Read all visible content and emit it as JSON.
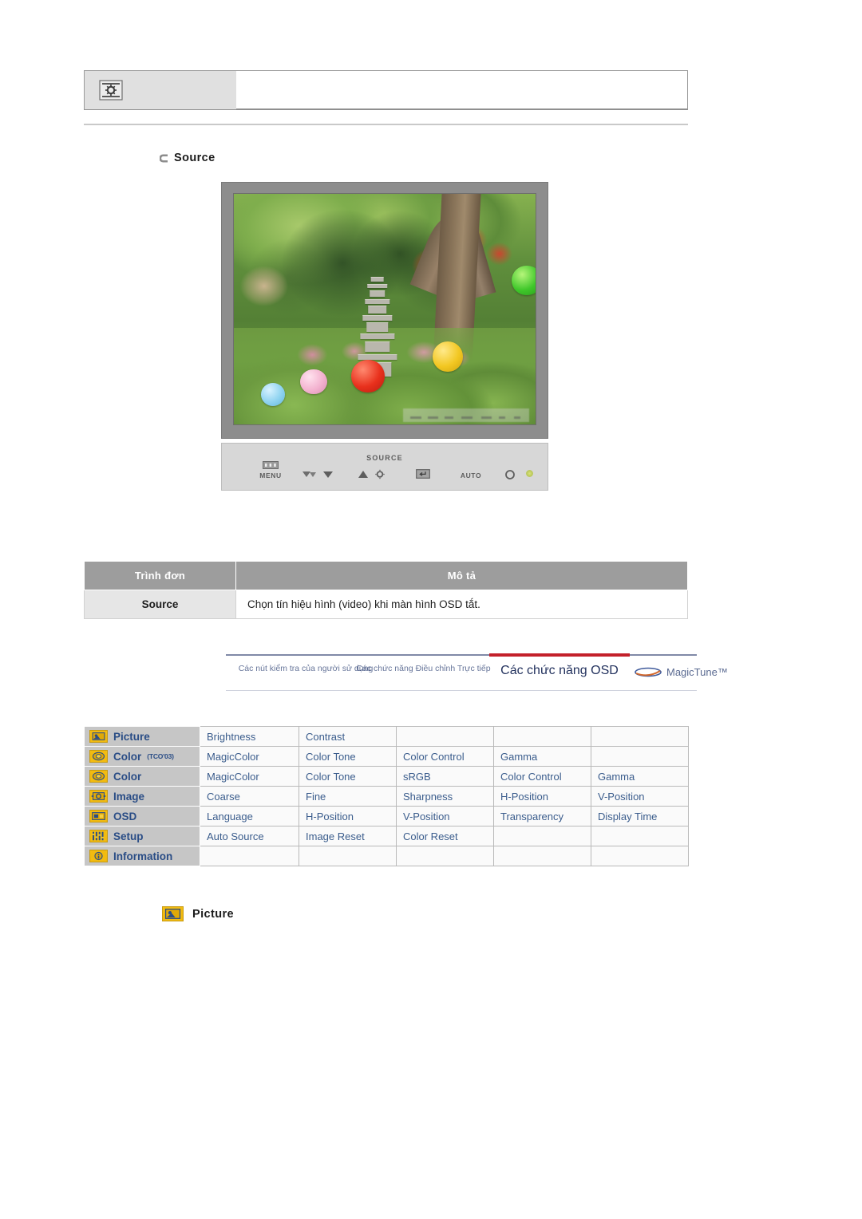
{
  "header": {
    "icon": "brightness-icon"
  },
  "source_section": {
    "bullet_icon": "c-arrow-bullet-icon",
    "heading": "Source"
  },
  "monitor": {
    "alt": "lcd-monitor-photo",
    "screen_image_description": "stone pagoda in a garden with trees and colored lanterns",
    "buttons": [
      {
        "name": "menu-button",
        "glyph": "menu-icon",
        "label": "MENU"
      },
      {
        "name": "down-button",
        "glyph": "down-arrow-icon",
        "label": ""
      },
      {
        "name": "up-brightness-button",
        "glyph": "up-arrow-brightness-icon",
        "label": ""
      },
      {
        "name": "source-enter-button",
        "glyph": "enter-icon",
        "label": ""
      },
      {
        "name": "auto-button",
        "glyph": "",
        "label": "AUTO"
      },
      {
        "name": "power-button",
        "glyph": "power-icon",
        "label": ""
      }
    ],
    "source_label": "SOURCE",
    "power_led": "power-led-indicator"
  },
  "desc_table": {
    "headers": [
      "Trình đơn",
      "Mô tả"
    ],
    "rows": [
      {
        "menu": "Source",
        "description": "Chọn tín hiệu hình (video) khi màn hình OSD tắt."
      }
    ]
  },
  "nav": {
    "items": [
      {
        "label": "Các nút kiểm tra của người sử dụng",
        "active": false
      },
      {
        "label": "Các chức năng Điều chỉnh Trực tiếp",
        "active": false
      },
      {
        "label": "Các chức năng OSD",
        "active": true
      }
    ],
    "logo": "MagicTune™",
    "logo_mark": "samsung-magictune-mark",
    "active_color": "#c3202a"
  },
  "osd_table": {
    "rows": [
      {
        "icon": "picture-icon",
        "menu": "Picture",
        "sup": "",
        "items": [
          "Brightness",
          "Contrast",
          "",
          "",
          ""
        ]
      },
      {
        "icon": "color-icon",
        "menu": "Color",
        "sup": "(TCO'03)",
        "items": [
          "MagicColor",
          "Color Tone",
          "Color Control",
          "Gamma",
          ""
        ]
      },
      {
        "icon": "color-icon",
        "menu": "Color",
        "sup": "",
        "items": [
          "MagicColor",
          "Color Tone",
          "sRGB",
          "Color Control",
          "Gamma"
        ]
      },
      {
        "icon": "image-icon",
        "menu": "Image",
        "sup": "",
        "items": [
          "Coarse",
          "Fine",
          "Sharpness",
          "H-Position",
          "V-Position"
        ]
      },
      {
        "icon": "osd-icon",
        "menu": "OSD",
        "sup": "",
        "items": [
          "Language",
          "H-Position",
          "V-Position",
          "Transparency",
          "Display Time"
        ]
      },
      {
        "icon": "setup-icon",
        "menu": "Setup",
        "sup": "",
        "items": [
          "Auto Source",
          "Image Reset",
          "Color Reset",
          "",
          ""
        ]
      },
      {
        "icon": "information-icon",
        "menu": "Information",
        "sup": "",
        "items": [
          "",
          "",
          "",
          "",
          ""
        ]
      }
    ]
  },
  "picture_section": {
    "icon": "picture-icon",
    "heading": "Picture"
  },
  "colors": {
    "icon_gold": "#f0b60d",
    "table_header_gray": "#9d9d9d",
    "menu_text_blue": "#2a4d86",
    "item_text_blue": "#3a5c8c"
  }
}
